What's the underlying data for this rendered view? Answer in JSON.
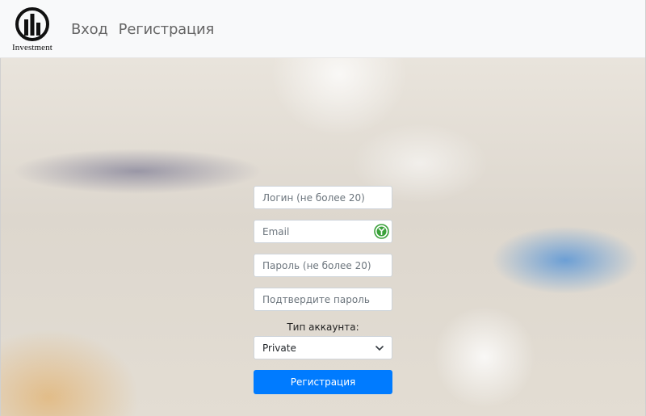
{
  "brand": {
    "logo_icon": "bar-chart-circle-icon",
    "name": "Investment"
  },
  "nav": {
    "items": [
      {
        "label": "Вход"
      },
      {
        "label": "Регистрация"
      }
    ]
  },
  "form": {
    "login": {
      "placeholder": "Логин (не более 20)",
      "value": ""
    },
    "email": {
      "placeholder": "Email",
      "value": "",
      "icon": "password-manager-icon"
    },
    "password": {
      "placeholder": "Пароль (не более 20)",
      "value": ""
    },
    "confirm": {
      "placeholder": "Подтвердите пароль",
      "value": ""
    },
    "account_type_label": "Тип аккаунта:",
    "account_type": {
      "selected": "Private"
    },
    "submit_label": "Регистрация"
  },
  "colors": {
    "primary": "#007bff",
    "navbar_bg": "#f8f9fa",
    "icon_green": "#3aa13a"
  }
}
